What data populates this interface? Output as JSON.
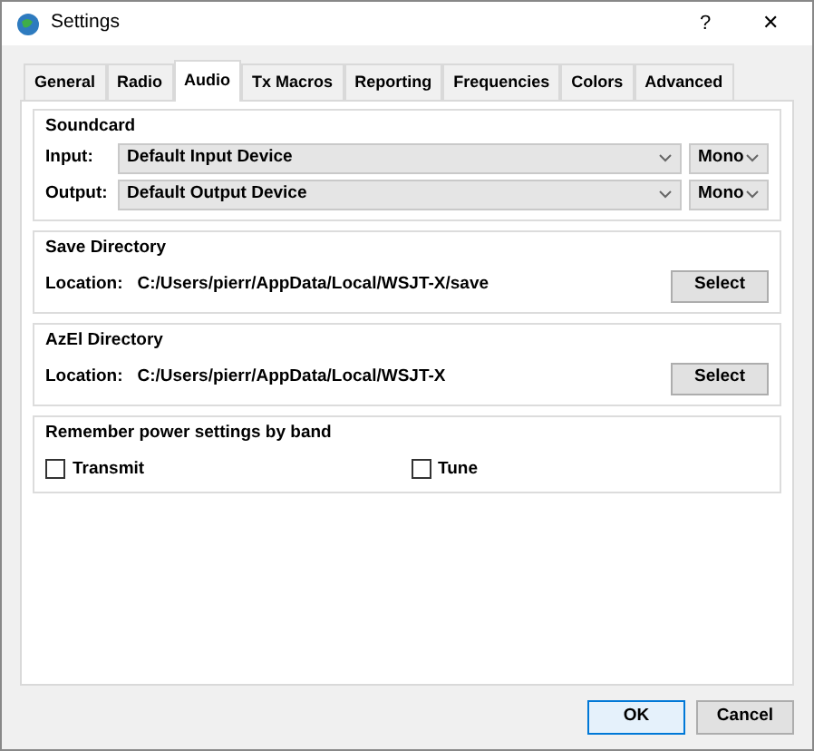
{
  "window": {
    "title": "Settings",
    "help": "?",
    "close": "✕"
  },
  "tabs": [
    {
      "label": "General",
      "selected": false
    },
    {
      "label": "Radio",
      "selected": false
    },
    {
      "label": "Audio",
      "selected": true
    },
    {
      "label": "Tx Macros",
      "selected": false
    },
    {
      "label": "Reporting",
      "selected": false
    },
    {
      "label": "Frequencies",
      "selected": false
    },
    {
      "label": "Colors",
      "selected": false
    },
    {
      "label": "Advanced",
      "selected": false
    }
  ],
  "soundcard": {
    "title": "Soundcard",
    "rows": [
      {
        "label": "Input:",
        "device": "Default Input Device",
        "channel": "Mono"
      },
      {
        "label": "Output:",
        "device": "Default Output Device",
        "channel": "Mono"
      }
    ]
  },
  "directories": [
    {
      "title": "Save Directory",
      "label": "Location:",
      "path": "C:/Users/pierr/AppData/Local/WSJT-X/save",
      "button": "Select"
    },
    {
      "title": "AzEl Directory",
      "label": "Location:",
      "path": "C:/Users/pierr/AppData/Local/WSJT-X",
      "button": "Select"
    }
  ],
  "power": {
    "title": "Remember power settings by band",
    "options": [
      {
        "label": "Transmit",
        "checked": false
      },
      {
        "label": "Tune",
        "checked": false
      }
    ]
  },
  "buttons": [
    {
      "label": "OK",
      "default": true
    },
    {
      "label": "Cancel",
      "default": false
    }
  ]
}
